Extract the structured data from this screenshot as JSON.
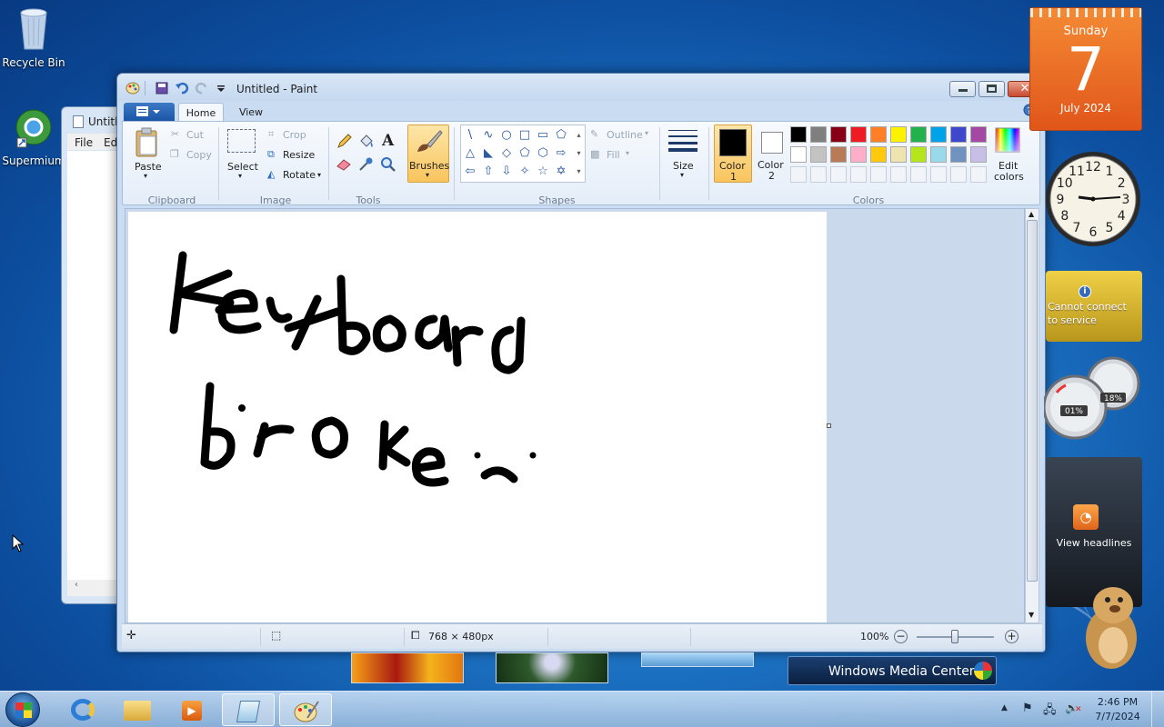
{
  "desktop": {
    "icons": [
      {
        "label": "Recycle Bin"
      },
      {
        "label": "Supermium"
      }
    ]
  },
  "background_window": {
    "title": "Untitl",
    "menu": [
      "File",
      "Ed"
    ]
  },
  "paint": {
    "title": "Untitled - Paint",
    "tabs": [
      "Home",
      "View"
    ],
    "clipboard": {
      "paste": "Paste",
      "cut": "Cut",
      "copy": "Copy",
      "label": "Clipboard"
    },
    "image": {
      "select": "Select",
      "crop": "Crop",
      "resize": "Resize",
      "rotate": "Rotate",
      "label": "Image"
    },
    "tools": {
      "label": "Tools",
      "text_glyph": "A"
    },
    "brushes": "Brushes",
    "shapes": {
      "outline": "Outline",
      "fill": "Fill",
      "label": "Shapes",
      "glyphs": [
        "\\",
        "∿",
        "○",
        "□",
        "▭",
        "⬠",
        "△",
        "◣",
        "◇",
        "⬠",
        "⬡",
        "⇨",
        "⇦",
        "⇧",
        "⇩",
        "✧",
        "☆",
        "✡"
      ]
    },
    "size": "Size",
    "color1": {
      "line1": "Color",
      "line2": "1"
    },
    "color2": {
      "line1": "Color",
      "line2": "2"
    },
    "edit_colors": {
      "line1": "Edit",
      "line2": "colors"
    },
    "colors_label": "Colors",
    "palette_row1": [
      "#000000",
      "#7f7f7f",
      "#880015",
      "#ed1c24",
      "#ff7f27",
      "#fff200",
      "#22b14c",
      "#00a2e8",
      "#3f48cc",
      "#a349a4"
    ],
    "palette_row2": [
      "#ffffff",
      "#c3c3c3",
      "#b97a57",
      "#ffaec9",
      "#ffc90e",
      "#efe4b0",
      "#b5e61d",
      "#99d9ea",
      "#7092be",
      "#c8bfe7"
    ],
    "canvas_strokes": "keyboard broke :(",
    "status": {
      "dimensions": "768 × 480px",
      "zoom": "100%"
    }
  },
  "gadgets": {
    "calendar": {
      "day": "Sunday",
      "date": "7",
      "month": "July 2024"
    },
    "clock_numbers": [
      "12",
      "1",
      "2",
      "3",
      "4",
      "5",
      "6",
      "7",
      "8",
      "9",
      "10",
      "11"
    ],
    "weather": {
      "line1": "Cannot connect",
      "line2": "to service"
    },
    "meter": {
      "cpu": "01%",
      "mem": "18%"
    },
    "feeds": {
      "text": "View headlines"
    }
  },
  "media_center": "Windows Media Center",
  "taskbar": {
    "time": "2:46 PM",
    "date": "7/7/2024"
  }
}
